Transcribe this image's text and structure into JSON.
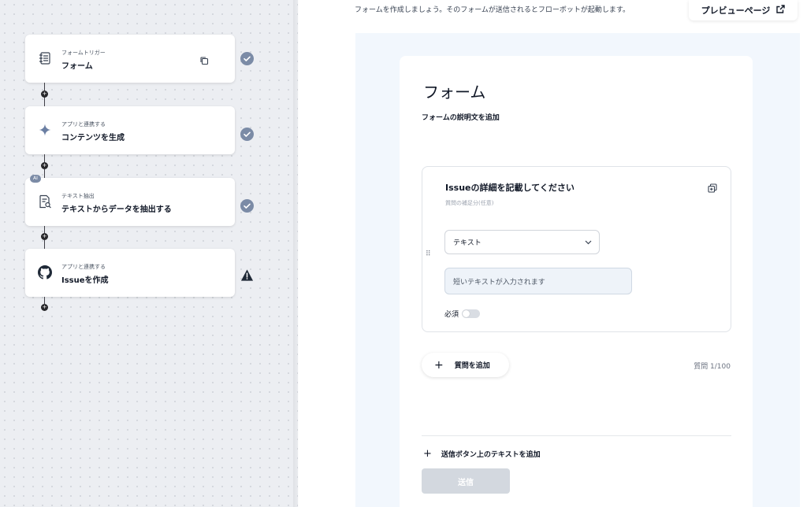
{
  "flow": {
    "nodes": [
      {
        "subtitle": "フォームトリガー",
        "title": "フォーム",
        "icon": "form-icon",
        "status": "check"
      },
      {
        "subtitle": "アプリと連携する",
        "title": "コンテンツを生成",
        "icon": "sparkle-icon",
        "status": "check"
      },
      {
        "subtitle": "テキスト抽出",
        "title": "テキストからデータを抽出する",
        "icon": "document-search-icon",
        "badge": "AI",
        "status": "check"
      },
      {
        "subtitle": "アプリと連携する",
        "title": "Issueを作成",
        "icon": "github-icon",
        "status": "warning"
      }
    ]
  },
  "header": {
    "intro": "フォームを作成しましょう。そのフォームが送信されるとフローボットが起動します。",
    "preview_label": "プレビューページ"
  },
  "form": {
    "title": "フォーム",
    "description_placeholder": "フォームの説明文を追加",
    "question": {
      "title": "Issueの詳細を記載してください",
      "description_placeholder": "質問の補足分(任意)",
      "type": "テキスト",
      "answer_placeholder": "短いテキストが入力されます",
      "required_label": "必須",
      "required": false
    },
    "add_question_label": "質問を追加",
    "question_count": "質問 1/100",
    "add_submit_text_label": "送信ボタン上のテキストを追加",
    "submit_label": "送信"
  },
  "colors": {
    "check": "#7b8ba6",
    "warning": "#1f2937",
    "preview_bg": "#f2f7fd",
    "submit_disabled": "#d3d8df"
  }
}
